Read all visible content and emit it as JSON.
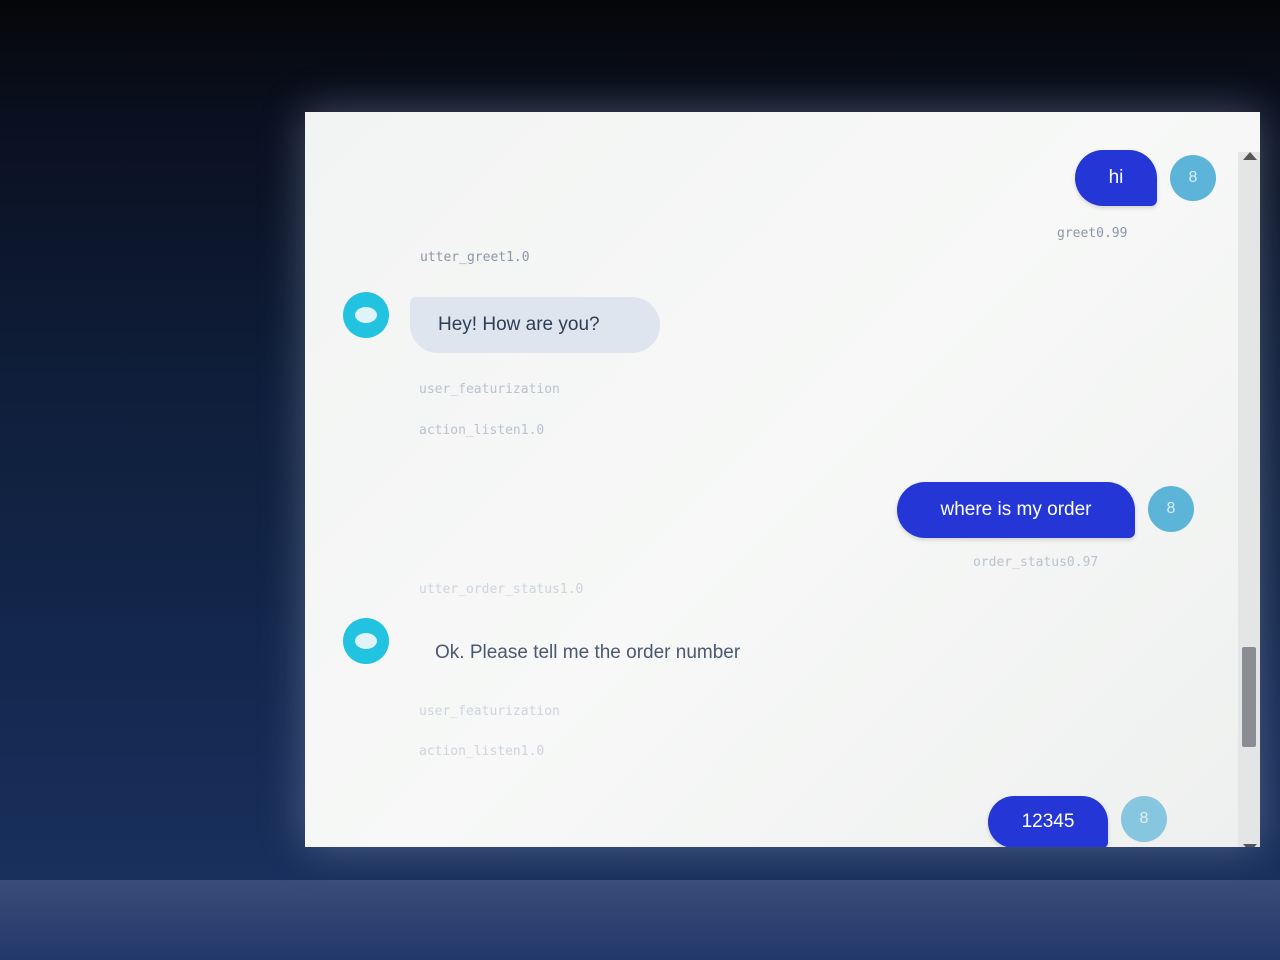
{
  "messages": [
    {
      "role": "user",
      "text": "hi",
      "avatar": "8",
      "intent": "greet0.99"
    },
    {
      "role": "bot",
      "action": "utter_greet1.0",
      "text": "Hey! How are you?",
      "events": [
        "user_featurization",
        "action_listen1.0"
      ]
    },
    {
      "role": "user",
      "text": "where is my order",
      "avatar": "8",
      "intent": "order_status0.97"
    },
    {
      "role": "bot",
      "action": "utter_order_status1.0",
      "text": "Ok. Please tell me the order number",
      "events": [
        "user_featurization",
        "action_listen1.0"
      ]
    },
    {
      "role": "user",
      "text": "12345",
      "avatar": "8"
    }
  ],
  "colors": {
    "user_bubble": "#2436d6",
    "user_avatar": "#5cb4d8",
    "bot_avatar": "#22c3e0",
    "bot_bubble": "#dfe5ee"
  },
  "icons": {
    "bot_avatar": "bot-avatar-icon",
    "user_avatar": "user-avatar-icon"
  }
}
